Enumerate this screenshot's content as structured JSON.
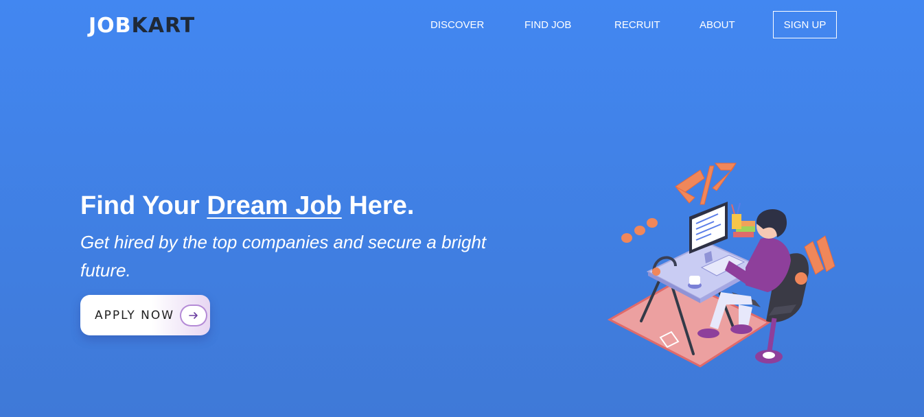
{
  "brand": {
    "part1": "JOB",
    "part2": "KART"
  },
  "nav": {
    "items": [
      {
        "label": "DISCOVER"
      },
      {
        "label": "FIND JOB"
      },
      {
        "label": "RECRUIT"
      },
      {
        "label": "ABOUT"
      }
    ],
    "signup_label": "SIGN UP"
  },
  "hero": {
    "title_prefix": "Find Your",
    "title_highlight": "Dream Job",
    "title_suffix": "Here.",
    "subtitle": "Get hired by the top companies and secure a bright future.",
    "cta_label": "APPLY NOW",
    "cta_icon": "arrow-right-icon",
    "illustration_icon": "developer-at-desk-illustration"
  },
  "colors": {
    "background_top": "#4287f1",
    "background_bottom": "#3f79d7",
    "logo_dark": "#1f2937",
    "accent_orange": "#f0875a",
    "accent_purple": "#8e3f9b"
  }
}
